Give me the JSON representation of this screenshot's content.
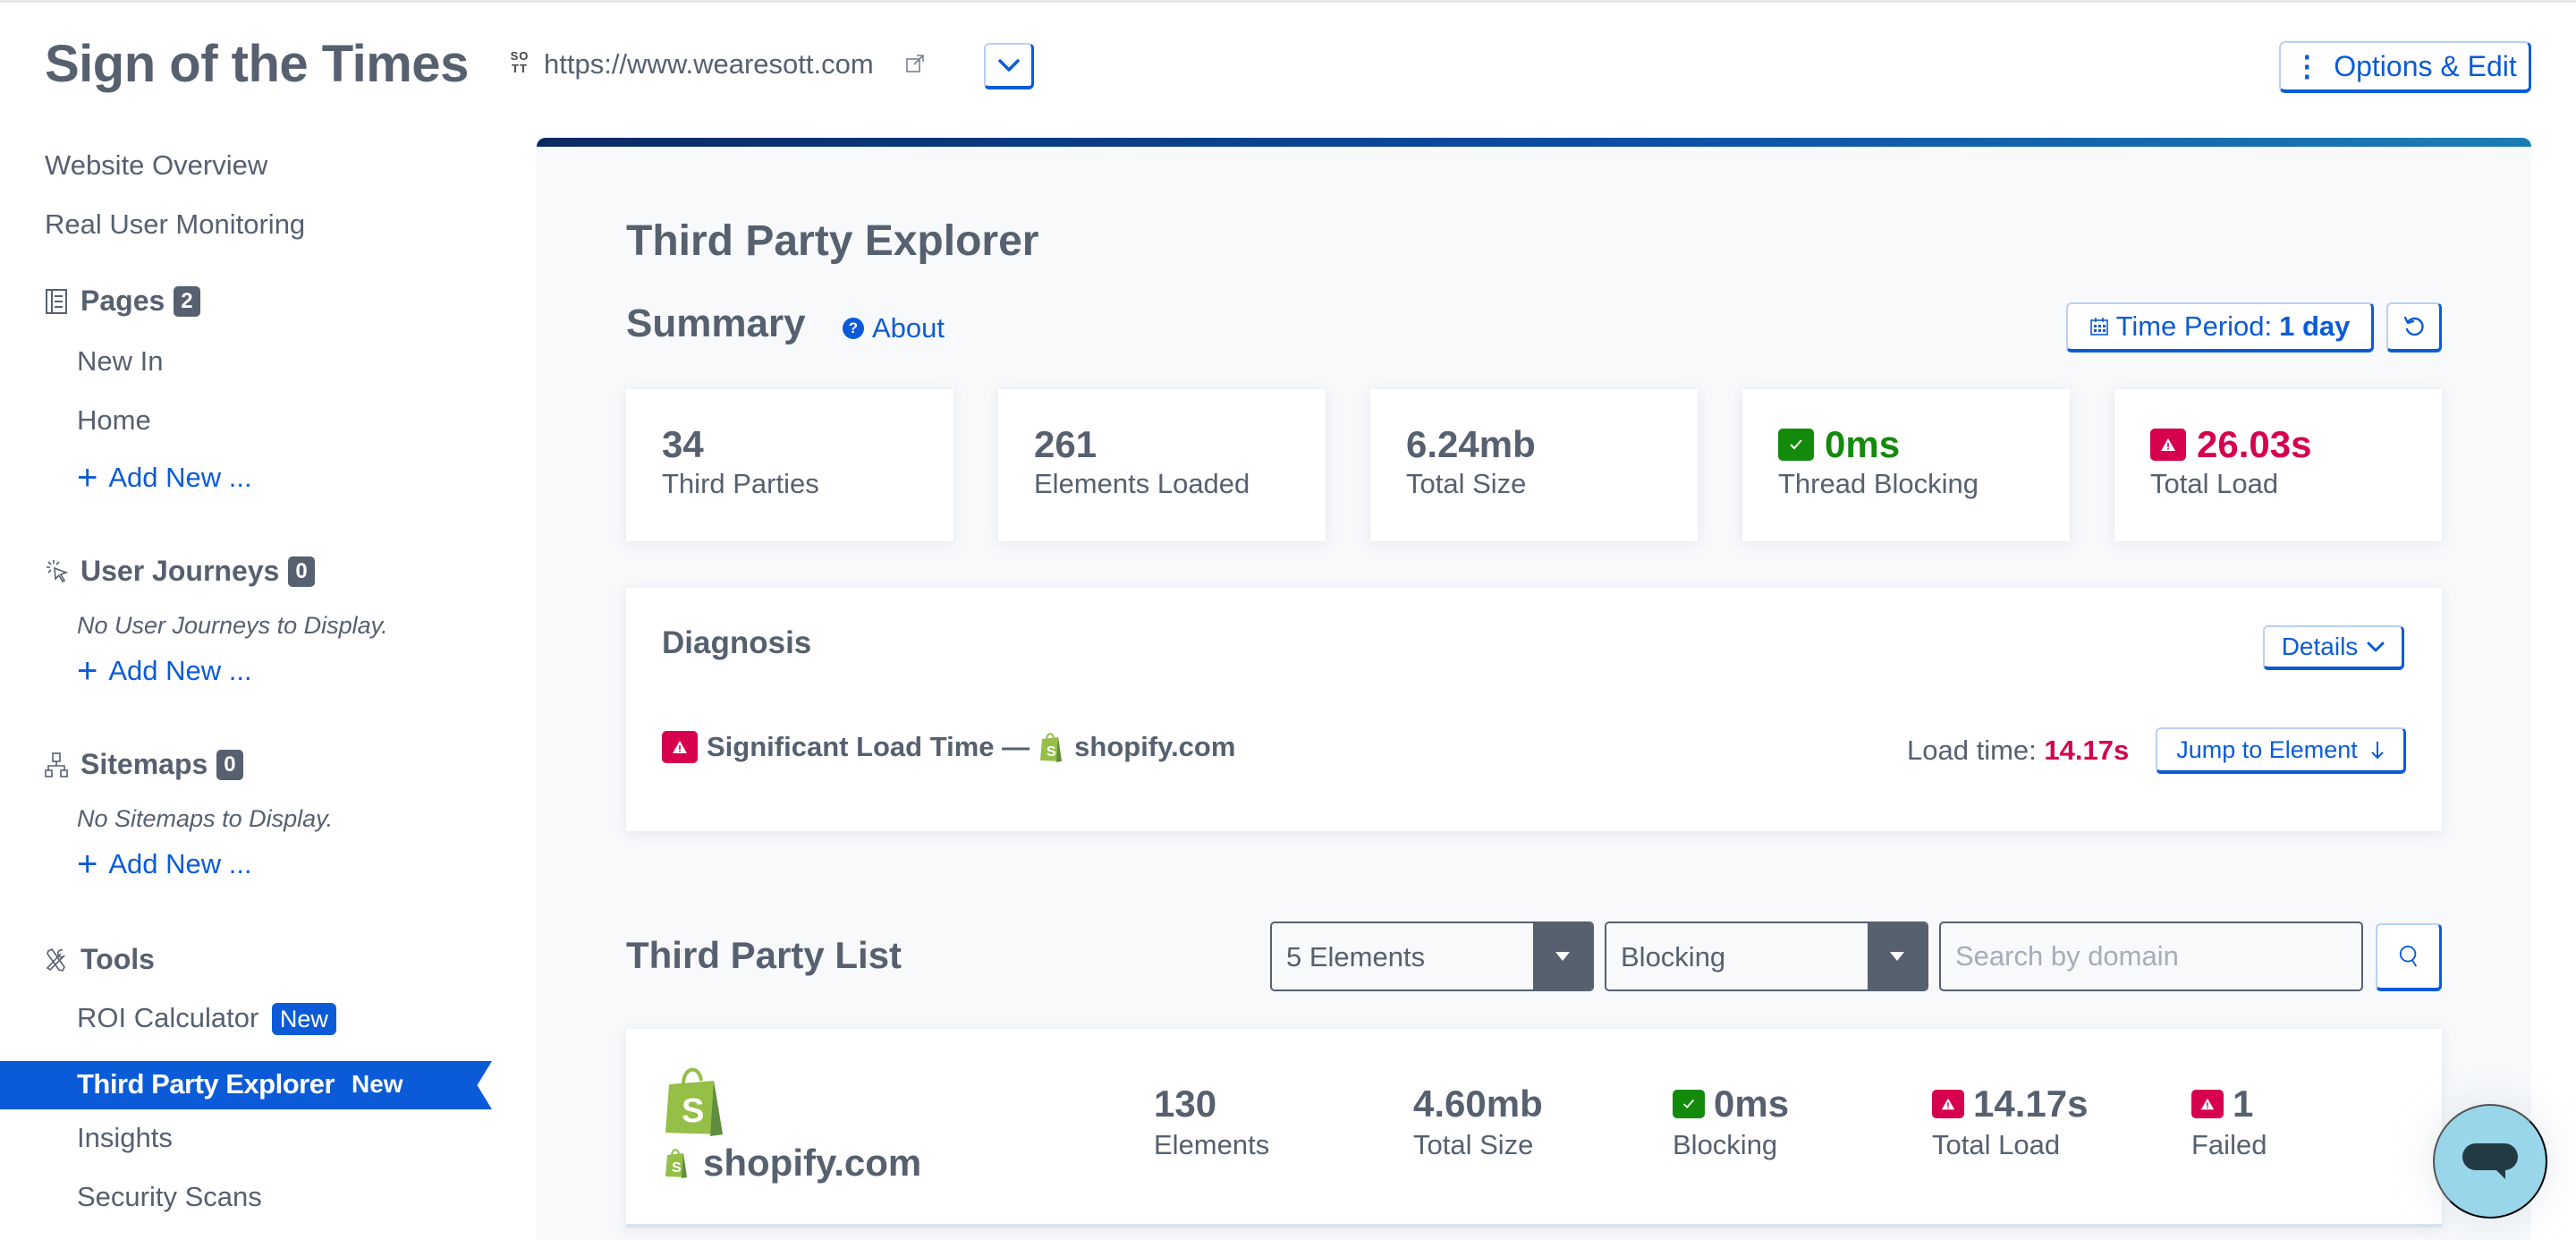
{
  "header": {
    "site_name": "Sign of the Times",
    "site_logo_text": "SO TT",
    "site_url": "https://www.wearesott.com",
    "options_label": "Options & Edit"
  },
  "sidebar": {
    "website_overview": "Website Overview",
    "rum": "Real User Monitoring",
    "pages": {
      "label": "Pages",
      "count": "2",
      "items": [
        "New In",
        "Home"
      ],
      "add_label": "Add New ..."
    },
    "journeys": {
      "label": "User Journeys",
      "count": "0",
      "empty_text": "No User Journeys to Display.",
      "add_label": "Add New ..."
    },
    "sitemaps": {
      "label": "Sitemaps",
      "count": "0",
      "empty_text": "No Sitemaps to Display.",
      "add_label": "Add New ..."
    },
    "tools": {
      "label": "Tools",
      "items": [
        {
          "label": "ROI Calculator",
          "badge": "New"
        },
        {
          "label": "Third Party Explorer",
          "badge": "New",
          "active": true
        },
        {
          "label": "Insights"
        },
        {
          "label": "Security Scans"
        }
      ]
    }
  },
  "main": {
    "page_title": "Third Party Explorer",
    "summary": {
      "title": "Summary",
      "about_label": "About",
      "time_period_label": "Time Period:",
      "time_period_value": "1 day",
      "stats": [
        {
          "value": "34",
          "label": "Third Parties",
          "status": "neutral"
        },
        {
          "value": "261",
          "label": "Elements Loaded",
          "status": "neutral"
        },
        {
          "value": "6.24mb",
          "label": "Total Size",
          "status": "neutral"
        },
        {
          "value": "0ms",
          "label": "Thread Blocking",
          "status": "good"
        },
        {
          "value": "26.03s",
          "label": "Total Load",
          "status": "bad"
        }
      ]
    },
    "diagnosis": {
      "title": "Diagnosis",
      "details_label": "Details",
      "issue_label": "Significant Load Time —",
      "issue_domain": "shopify.com",
      "load_time_label": "Load time:",
      "load_time_value": "14.17s",
      "jump_label": "Jump to Element"
    },
    "third_party_list": {
      "title": "Third Party List",
      "count_select": "5 Elements",
      "sort_select": "Blocking",
      "search_placeholder": "Search by domain",
      "search_value": "",
      "rows": [
        {
          "domain": "shopify.com",
          "elements": "130",
          "elements_label": "Elements",
          "size": "4.60mb",
          "size_label": "Total Size",
          "blocking": "0ms",
          "blocking_label": "Blocking",
          "blocking_status": "good",
          "load": "14.17s",
          "load_label": "Total Load",
          "load_status": "bad",
          "failed": "1",
          "failed_label": "Failed",
          "failed_status": "bad"
        }
      ]
    }
  },
  "colors": {
    "accent": "#0b5bd8",
    "text": "#56606f",
    "good": "#148a0c",
    "bad": "#d6004f",
    "shopify_green": "#95bf47",
    "chat_bubble": "#99d6ea"
  }
}
